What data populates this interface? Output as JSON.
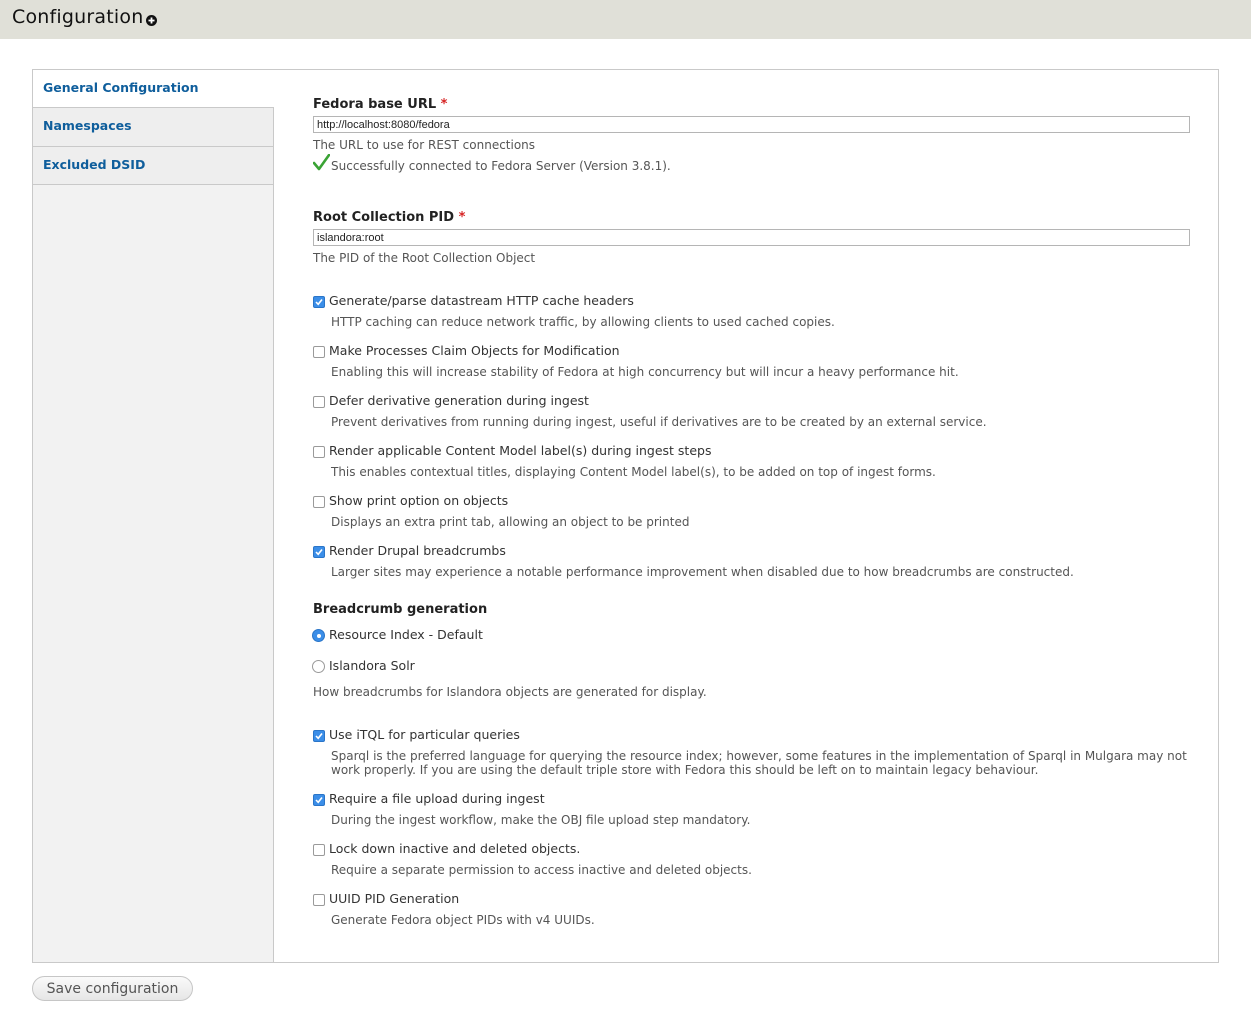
{
  "header": {
    "title": "Configuration",
    "shortcut_icon": "plus-circle-icon"
  },
  "tabs": [
    {
      "label": "General Configuration",
      "selected": true
    },
    {
      "label": "Namespaces",
      "selected": false
    },
    {
      "label": "Excluded DSID",
      "selected": false
    }
  ],
  "fedora_url": {
    "label": "Fedora base URL",
    "required_marker": "*",
    "value": "http://localhost:8080/fedora",
    "description": "The URL to use for REST connections",
    "status_icon": "check-mark-icon",
    "status_text": "Successfully connected to Fedora Server (Version 3.8.1)."
  },
  "root_pid": {
    "label": "Root Collection PID",
    "required_marker": "*",
    "value": "islandora:root",
    "description": "The PID of the Root Collection Object"
  },
  "options": [
    {
      "label": "Generate/parse datastream HTTP cache headers",
      "checked": true,
      "description": "HTTP caching can reduce network traffic, by allowing clients to used cached copies."
    },
    {
      "label": "Make Processes Claim Objects for Modification",
      "checked": false,
      "description": "Enabling this will increase stability of Fedora at high concurrency but will incur a heavy performance hit."
    },
    {
      "label": "Defer derivative generation during ingest",
      "checked": false,
      "description": "Prevent derivatives from running during ingest, useful if derivatives are to be created by an external service."
    },
    {
      "label": "Render applicable Content Model label(s) during ingest steps",
      "checked": false,
      "description": "This enables contextual titles, displaying Content Model label(s), to be added on top of ingest forms."
    },
    {
      "label": "Show print option on objects",
      "checked": false,
      "description": "Displays an extra print tab, allowing an object to be printed"
    },
    {
      "label": "Render Drupal breadcrumbs",
      "checked": true,
      "description": "Larger sites may experience a notable performance improvement when disabled due to how breadcrumbs are constructed."
    }
  ],
  "breadcrumb": {
    "title": "Breadcrumb generation",
    "options": [
      {
        "label": "Resource Index - Default",
        "selected": true
      },
      {
        "label": "Islandora Solr",
        "selected": false
      }
    ],
    "description": "How breadcrumbs for Islandora objects are generated for display."
  },
  "options2": [
    {
      "label": "Use iTQL for particular queries",
      "checked": true,
      "description": "Sparql is the preferred language for querying the resource index; however, some features in the implementation of Sparql in Mulgara may not work properly. If you are using the default triple store with Fedora this should be left on to maintain legacy behaviour."
    },
    {
      "label": "Require a file upload during ingest",
      "checked": true,
      "description": "During the ingest workflow, make the OBJ file upload step mandatory."
    },
    {
      "label": "Lock down inactive and deleted objects.",
      "checked": false,
      "description": "Require a separate permission to access inactive and deleted objects."
    },
    {
      "label": "UUID PID Generation",
      "checked": false,
      "description": "Generate Fedora object PIDs with v4 UUIDs."
    }
  ],
  "save_label": "Save configuration",
  "colors": {
    "link": "#0f5e9c",
    "check": "#3b8ee8",
    "success": "#3aa335",
    "required": "#d62424"
  }
}
